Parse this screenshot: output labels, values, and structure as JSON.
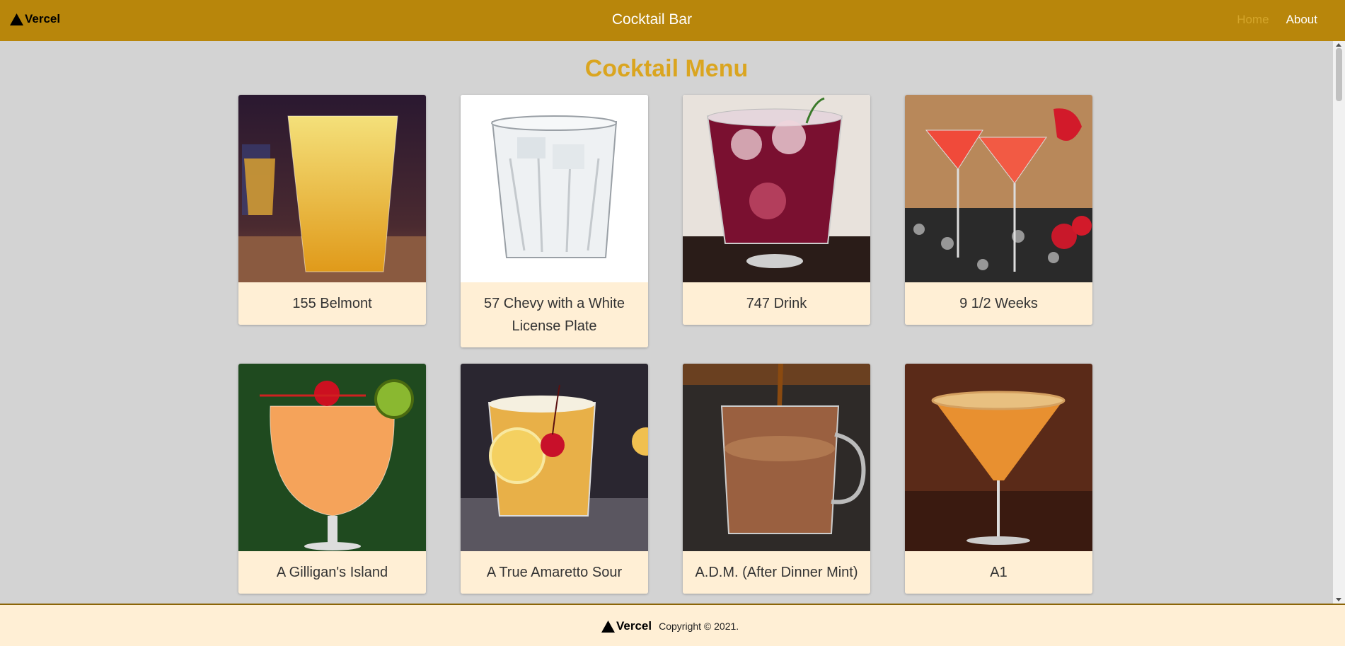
{
  "nav": {
    "brand": "Vercel",
    "title": "Cocktail Bar",
    "links": [
      "Home",
      "About"
    ]
  },
  "main": {
    "title": "Cocktail Menu",
    "cards": [
      {
        "name": "155 Belmont"
      },
      {
        "name": "57 Chevy with a White License Plate"
      },
      {
        "name": "747 Drink"
      },
      {
        "name": "9 1/2 Weeks"
      },
      {
        "name": "A Gilligan's Island"
      },
      {
        "name": "A True Amaretto Sour"
      },
      {
        "name": "A.D.M. (After Dinner Mint)"
      },
      {
        "name": "A1"
      }
    ]
  },
  "footer": {
    "brand": "Vercel",
    "copyright": "Copyright © 2021."
  },
  "colors": {
    "navbar": "#b8860b",
    "title": "#daa520",
    "card_body": "#ffefd5",
    "background": "#d3d3d3"
  }
}
